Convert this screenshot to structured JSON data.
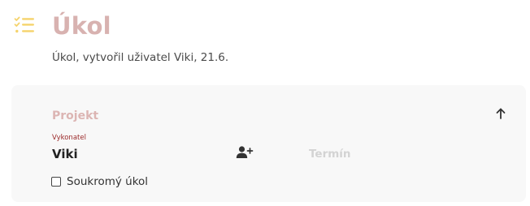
{
  "header": {
    "icon": "checklist-icon",
    "title": "Úkol",
    "subtitle": "Úkol, vytvořil uživatel Viki, 21.6."
  },
  "card": {
    "project_placeholder": "Projekt",
    "collapse_icon": "arrow-up-icon",
    "assignee_caption": "Vykonatel",
    "assignee_value": "Viki",
    "add_assignee_icon": "add-user-icon",
    "deadline_placeholder": "Termín",
    "private_checkbox_label": "Soukromý úkol",
    "private_checked": false
  },
  "colors": {
    "title": "#d8b2b0",
    "icon_accent": "#f5d36b",
    "project_placeholder": "#dcb5b3",
    "assignee_caption": "#9b2a2a",
    "deadline_placeholder": "#d3d3d3",
    "card_background": "#f8f8f8"
  }
}
